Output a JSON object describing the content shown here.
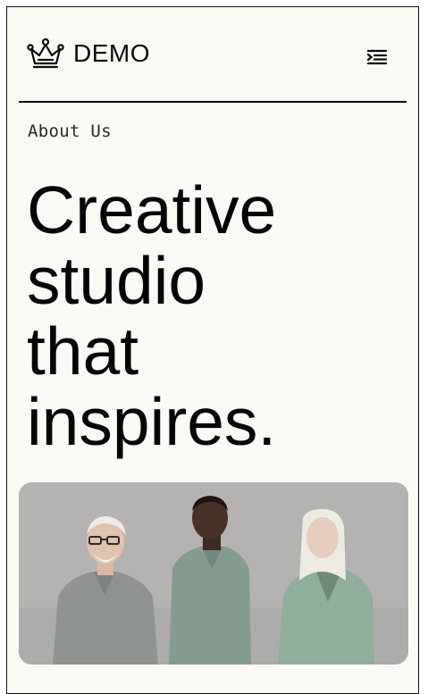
{
  "brand": {
    "name": "DEMO",
    "logo_icon": "crown-icon"
  },
  "header": {
    "menu_icon": "menu-indent-icon"
  },
  "page": {
    "eyebrow": "About Us",
    "headline_lines": [
      "Creative",
      "studio",
      "that",
      "inspires."
    ]
  },
  "hero": {
    "image_icon": "team-photo"
  },
  "colors": {
    "background": "#fbf9f4",
    "text": "#050505",
    "muted_text": "#2a2a2a"
  }
}
